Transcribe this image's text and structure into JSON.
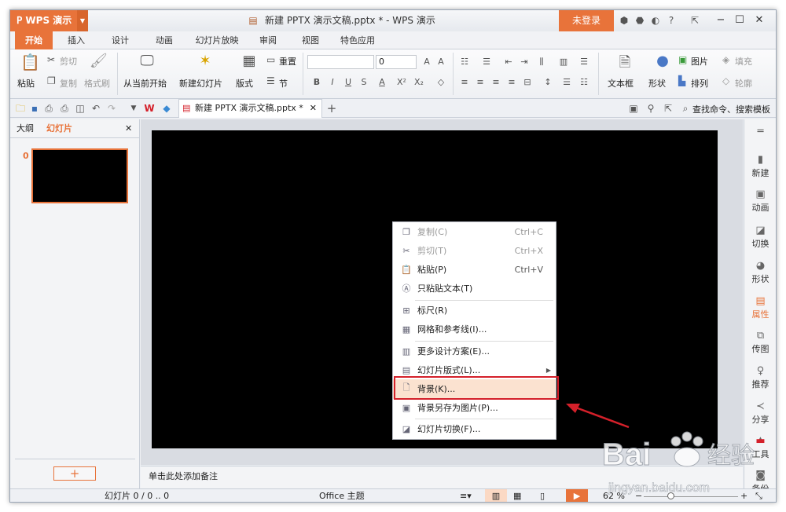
{
  "app": {
    "menu_label": "WPS 演示",
    "doc_title": "新建 PPTX 演示文稿.pptx * - WPS 演示",
    "login_label": "未登录"
  },
  "ribbon_tabs": [
    "开始",
    "插入",
    "设计",
    "动画",
    "幻灯片放映",
    "审阅",
    "视图",
    "特色应用"
  ],
  "ribbon": {
    "paste": "粘贴",
    "cut": "剪切",
    "copy": "复制",
    "format_painter": "格式刷",
    "from_current": "从当前开始",
    "new_slide": "新建幻灯片",
    "layout": "版式",
    "reset": "重置",
    "section": "节",
    "font_size_value": "0",
    "textbox": "文本框",
    "shape": "形状",
    "picture": "图片",
    "arrange": "排列",
    "fill": "填充",
    "outline": "轮廓"
  },
  "doc_tab": {
    "label": "新建 PPTX 演示文稿.pptx *"
  },
  "search": {
    "label": "查找命令、搜索模板"
  },
  "left_pane": {
    "tab_outline": "大纲",
    "tab_slides": "幻灯片",
    "thumb_number": "0",
    "add_button": "+"
  },
  "notes": {
    "placeholder": "单击此处添加备注"
  },
  "context_menu": {
    "items": [
      {
        "label": "复制(C)",
        "shortcut": "Ctrl+C"
      },
      {
        "label": "剪切(T)",
        "shortcut": "Ctrl+X"
      },
      {
        "label": "粘贴(P)",
        "shortcut": "Ctrl+V"
      },
      {
        "label": "只粘贴文本(T)",
        "shortcut": ""
      },
      {
        "label": "标尺(R)",
        "shortcut": ""
      },
      {
        "label": "网格和参考线(I)...",
        "shortcut": ""
      },
      {
        "label": "更多设计方案(E)...",
        "shortcut": ""
      },
      {
        "label": "幻灯片版式(L)...",
        "shortcut": ""
      },
      {
        "label": "背景(K)...",
        "shortcut": ""
      },
      {
        "label": "背景另存为图片(P)...",
        "shortcut": ""
      },
      {
        "label": "幻灯片切换(F)...",
        "shortcut": ""
      }
    ]
  },
  "right_sidebar": [
    "新建",
    "动画",
    "切换",
    "形状",
    "属性",
    "传图",
    "推荐",
    "分享",
    "工具",
    "备份"
  ],
  "status": {
    "slide_info": "幻灯片 0 / 0 .. 0",
    "theme": "Office 主题",
    "zoom": "62 %"
  },
  "watermark": {
    "brand": "Bai",
    "brand2": "经验",
    "url": "jingyan.baidu.com"
  },
  "colors": {
    "accent": "#e8733a",
    "highlight": "#d4202a"
  }
}
